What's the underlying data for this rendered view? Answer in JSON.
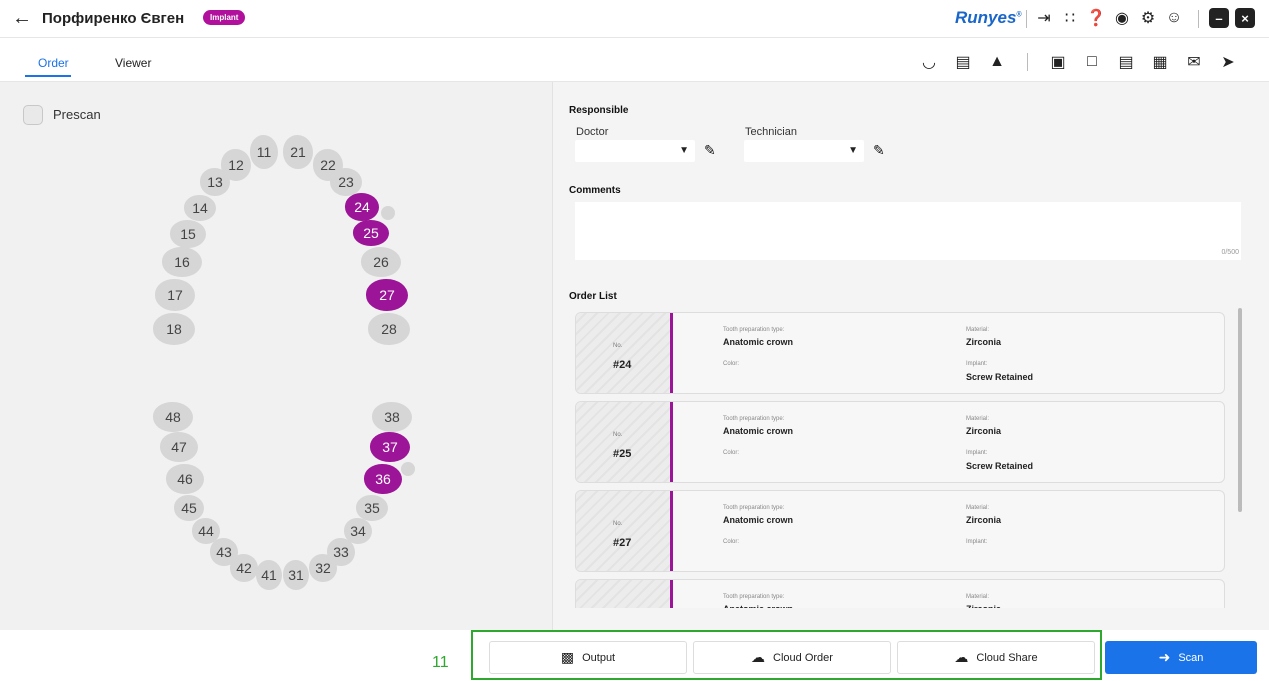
{
  "header": {
    "back_icon": "arrow-left-icon",
    "patient_name": "Порфиренко Євген",
    "badge": "Implant",
    "brand": "Runyes",
    "brand_mark": "®"
  },
  "tabs": [
    {
      "label": "Order",
      "active": true
    },
    {
      "label": "Viewer",
      "active": false
    }
  ],
  "prescan": {
    "label": "Prescan"
  },
  "teeth": [
    {
      "n": "11",
      "selected": false
    },
    {
      "n": "12",
      "selected": false
    },
    {
      "n": "13",
      "selected": false
    },
    {
      "n": "14",
      "selected": false
    },
    {
      "n": "15",
      "selected": false
    },
    {
      "n": "16",
      "selected": false
    },
    {
      "n": "17",
      "selected": false
    },
    {
      "n": "18",
      "selected": false
    },
    {
      "n": "21",
      "selected": false
    },
    {
      "n": "22",
      "selected": false
    },
    {
      "n": "23",
      "selected": false
    },
    {
      "n": "24",
      "selected": true
    },
    {
      "n": "25",
      "selected": true
    },
    {
      "n": "26",
      "selected": false
    },
    {
      "n": "27",
      "selected": true
    },
    {
      "n": "28",
      "selected": false
    },
    {
      "n": "48",
      "selected": false
    },
    {
      "n": "47",
      "selected": false
    },
    {
      "n": "46",
      "selected": false
    },
    {
      "n": "45",
      "selected": false
    },
    {
      "n": "44",
      "selected": false
    },
    {
      "n": "43",
      "selected": false
    },
    {
      "n": "42",
      "selected": false
    },
    {
      "n": "41",
      "selected": false
    },
    {
      "n": "31",
      "selected": false
    },
    {
      "n": "32",
      "selected": false
    },
    {
      "n": "33",
      "selected": false
    },
    {
      "n": "34",
      "selected": false
    },
    {
      "n": "35",
      "selected": false
    },
    {
      "n": "36",
      "selected": true
    },
    {
      "n": "37",
      "selected": true
    },
    {
      "n": "38",
      "selected": false
    }
  ],
  "responsible": {
    "title": "Responsible",
    "doctor_label": "Doctor",
    "technician_label": "Technician"
  },
  "comments": {
    "title": "Comments",
    "counter": "0/500"
  },
  "order_list": {
    "title": "Order List",
    "labels": {
      "no": "No.",
      "prep": "Tooth preparation type:",
      "color": "Color:",
      "material": "Material:",
      "implant": "Implant:"
    },
    "items": [
      {
        "no": "#24",
        "prep": "Anatomic crown",
        "material": "Zirconia",
        "implant": "Screw Retained"
      },
      {
        "no": "#25",
        "prep": "Anatomic crown",
        "material": "Zirconia",
        "implant": "Screw Retained"
      },
      {
        "no": "#27",
        "prep": "Anatomic crown",
        "material": "Zirconia",
        "implant": ""
      },
      {
        "no": "",
        "prep": "Anatomic crown",
        "material": "Zirconia",
        "implant": ""
      }
    ]
  },
  "bottom": {
    "highlight_number": "11",
    "output": "Output",
    "cloud_order": "Cloud Order",
    "cloud_share": "Cloud Share",
    "scan": "Scan"
  },
  "colors": {
    "accent": "#1a73e8",
    "selected_tooth": "#9c1497",
    "highlight": "#2ea82e"
  }
}
